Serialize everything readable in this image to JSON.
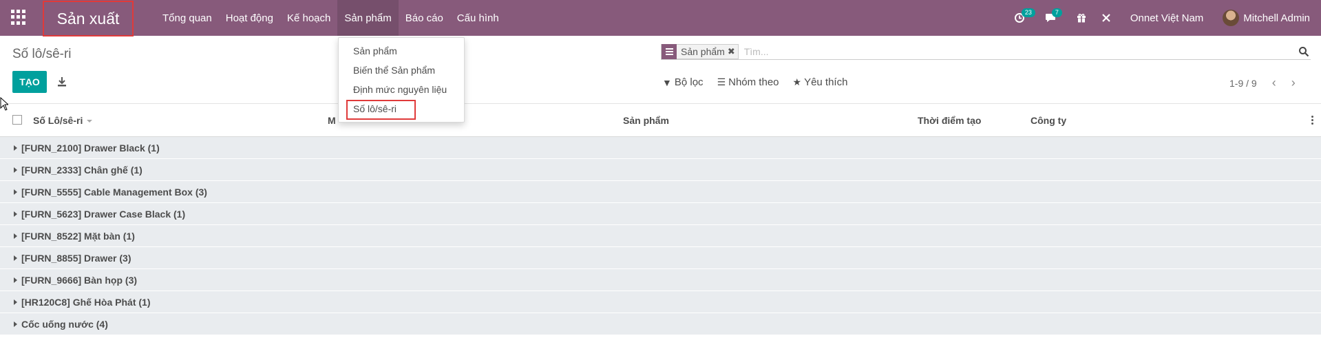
{
  "app": {
    "name": "Sản xuất"
  },
  "menu": [
    {
      "label": "Tổng quan",
      "active": false
    },
    {
      "label": "Hoạt động",
      "active": false
    },
    {
      "label": "Kế hoạch",
      "active": false
    },
    {
      "label": "Sản phẩm",
      "active": true
    },
    {
      "label": "Báo cáo",
      "active": false
    },
    {
      "label": "Cấu hình",
      "active": false
    }
  ],
  "systray": {
    "activity_icon": "clock-icon",
    "activity_count": "23",
    "messages_icon": "chat-icon",
    "messages_count": "7",
    "gift_icon": "gift-icon",
    "debug_icon": "tools-icon",
    "company": "Onnet Việt Nam",
    "user": "Mitchell Admin"
  },
  "dropdown": {
    "items": [
      "Sản phẩm",
      "Biến thể Sản phẩm",
      "Định mức nguyên liệu",
      "Số lô/sê-ri"
    ],
    "highlighted_index": 3
  },
  "control_panel": {
    "breadcrumb": "Số lô/sê-ri",
    "create_label": "TẠO",
    "search": {
      "facet_label": "Sản phẩm",
      "placeholder": "Tìm..."
    },
    "filters_label": "Bộ lọc",
    "groupby_label": "Nhóm theo",
    "favorites_label": "Yêu thích",
    "pager": "1-9 / 9"
  },
  "table": {
    "columns": [
      "Số Lô/sê-ri",
      "M",
      "Sản phẩm",
      "Thời điểm tạo",
      "Công ty"
    ],
    "groups": [
      "[FURN_2100] Drawer Black (1)",
      "[FURN_2333] Chân ghế (1)",
      "[FURN_5555] Cable Management Box (3)",
      "[FURN_5623] Drawer Case Black (1)",
      "[FURN_8522] Mặt bàn (1)",
      "[FURN_8855] Drawer (3)",
      "[FURN_9666] Bàn họp (3)",
      "[HR120C8] Ghế Hòa Phát (1)",
      "Cốc uống nước (4)"
    ]
  },
  "colors": {
    "brand": "#875a7b",
    "primary": "#00a09d",
    "highlight": "#e03a3a",
    "group_bg": "#e9ecef"
  }
}
